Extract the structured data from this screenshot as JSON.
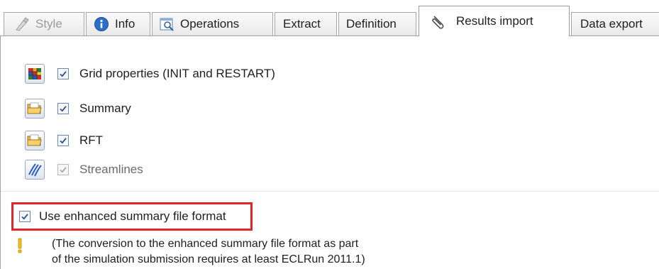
{
  "tabs": [
    {
      "label": "Style",
      "icon": "style-icon",
      "disabled": true
    },
    {
      "label": "Info",
      "icon": "info-icon"
    },
    {
      "label": "Operations",
      "icon": "operations-icon"
    },
    {
      "label": "Extract"
    },
    {
      "label": "Definition"
    },
    {
      "label": "Results import",
      "icon": "paperclip-icon",
      "active": true
    },
    {
      "label": "Data export"
    }
  ],
  "import_options": [
    {
      "label": "Grid properties (INIT and RESTART)",
      "icon": "grid-properties-icon",
      "checked": true,
      "enabled": true
    },
    {
      "label": "Summary",
      "icon": "folder-icon",
      "checked": true,
      "enabled": true
    },
    {
      "label": "RFT",
      "icon": "folder-icon",
      "checked": true,
      "enabled": true
    },
    {
      "label": "Streamlines",
      "icon": "streamlines-icon",
      "checked": true,
      "enabled": false
    }
  ],
  "enhanced_summary": {
    "label": "Use enhanced summary file format",
    "checked": true
  },
  "note": {
    "line1": "(The conversion to the enhanced summary file format as part",
    "line2": "of the simulation submission requires at least ECLRun 2011.1)"
  },
  "colors": {
    "highlight_border": "#e0262c",
    "checkbox_check": "#2b4f86"
  }
}
